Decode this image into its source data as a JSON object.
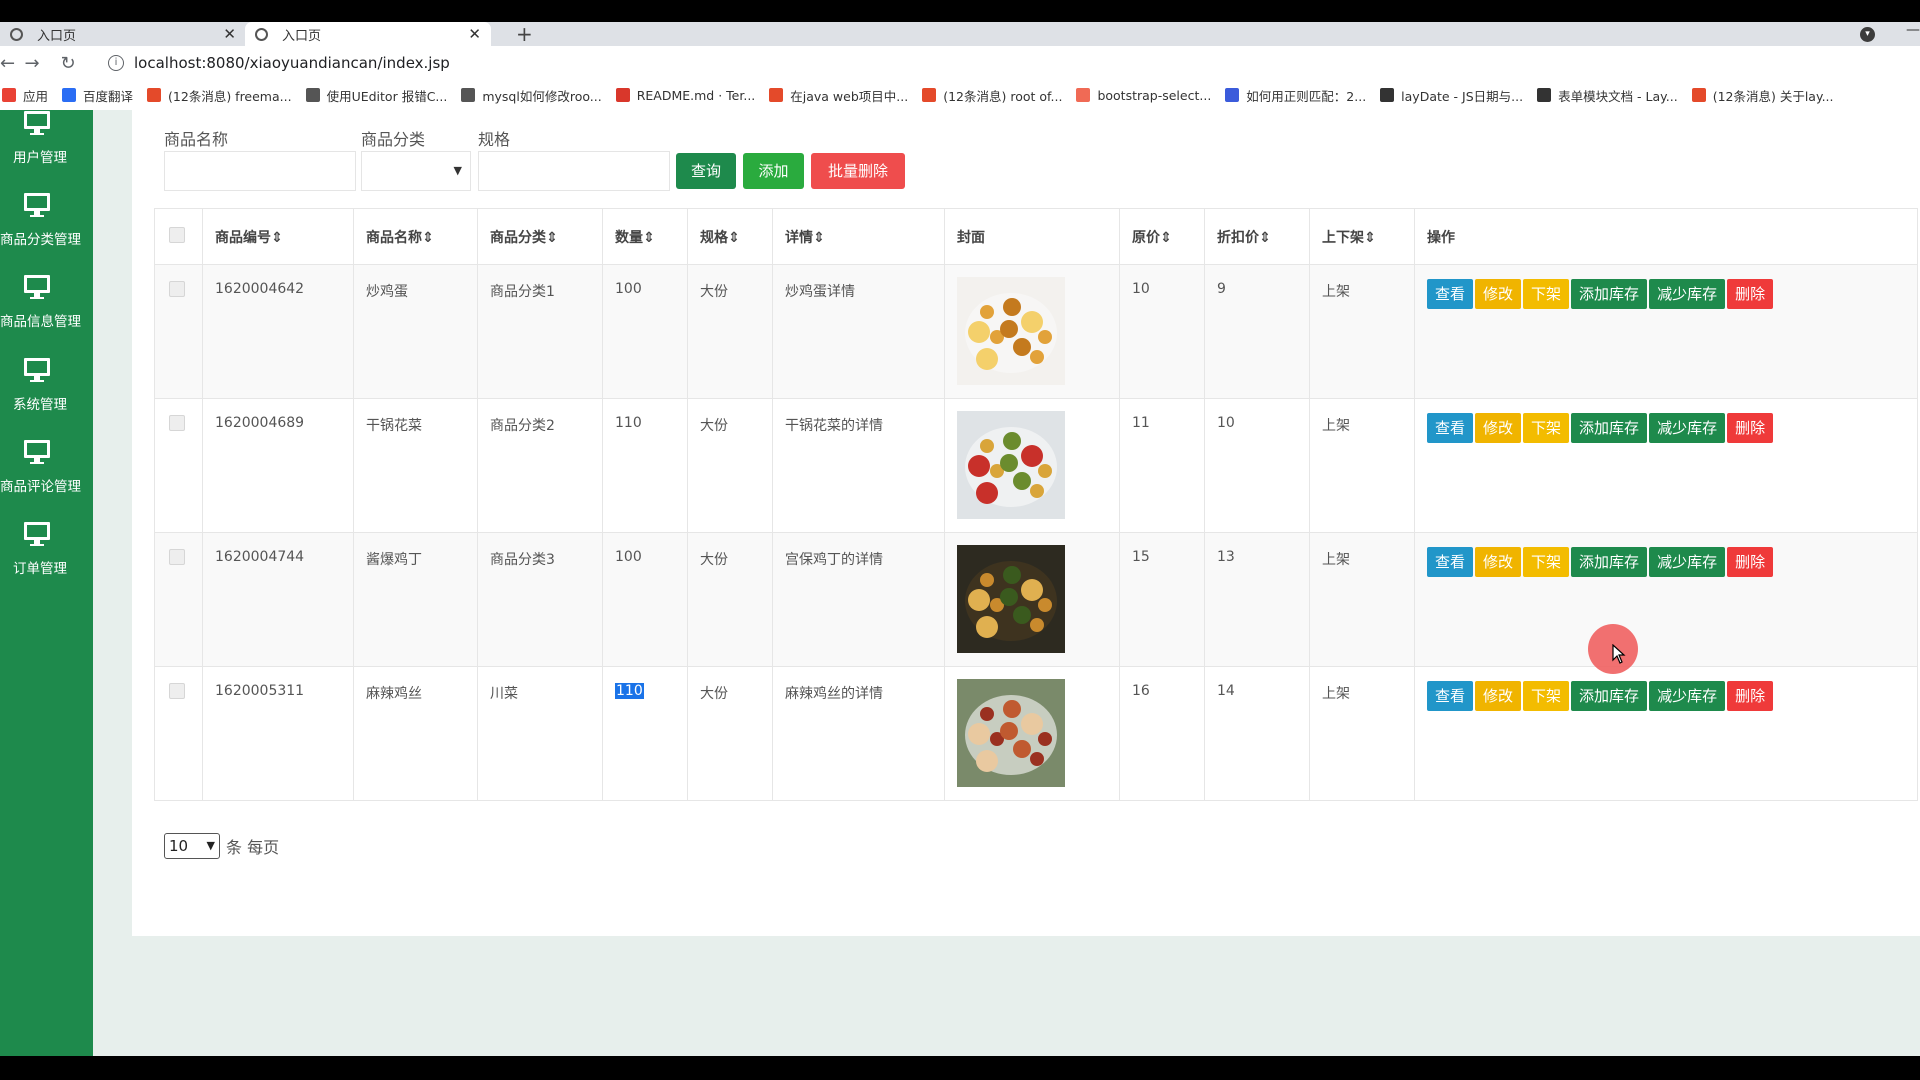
{
  "browser": {
    "tabs": [
      {
        "title": "入口页"
      },
      {
        "title": "入口页"
      }
    ],
    "url": "localhost:8080/xiaoyuandiancan/index.jsp",
    "bookmarks": [
      {
        "label": "应用",
        "color": "#e94235"
      },
      {
        "label": "百度翻译",
        "color": "#2a6df4"
      },
      {
        "label": "(12条消息) freema...",
        "color": "#e44a2a"
      },
      {
        "label": "使用UEditor 报错C...",
        "color": "#555555"
      },
      {
        "label": "mysql如何修改roo...",
        "color": "#555555"
      },
      {
        "label": "README.md · Ter...",
        "color": "#d9372b"
      },
      {
        "label": "在java web项目中...",
        "color": "#e44a2a"
      },
      {
        "label": "(12条消息) root of...",
        "color": "#e44a2a"
      },
      {
        "label": "bootstrap-select...",
        "color": "#f06a55"
      },
      {
        "label": "如何用正则匹配：2...",
        "color": "#3b5bdb"
      },
      {
        "label": "layDate - JS日期与...",
        "color": "#333333"
      },
      {
        "label": "表单模块文档 - Lay...",
        "color": "#333333"
      },
      {
        "label": "(12条消息) 关于lay...",
        "color": "#e44a2a"
      }
    ]
  },
  "sidebar": {
    "items": [
      {
        "label": "用户管理"
      },
      {
        "label": "商品分类管理"
      },
      {
        "label": "商品信息管理"
      },
      {
        "label": "系统管理"
      },
      {
        "label": "商品评论管理"
      },
      {
        "label": "订单管理"
      }
    ]
  },
  "search": {
    "name_label": "商品名称",
    "category_label": "商品分类",
    "spec_label": "规格",
    "query_button": "查询",
    "add_button": "添加",
    "batch_delete_button": "批量删除"
  },
  "table": {
    "headers": [
      "商品编号",
      "商品名称",
      "商品分类",
      "数量",
      "规格",
      "详情",
      "封面",
      "原价",
      "折扣价",
      "上下架",
      "操作"
    ],
    "sort_icon": "⇕",
    "rows": [
      {
        "id": "1620004642",
        "name": "炒鸡蛋",
        "category": "商品分类1",
        "quantity": "100",
        "spec": "大份",
        "detail": "炒鸡蛋详情",
        "price": "10",
        "discount": "9",
        "status": "上架"
      },
      {
        "id": "1620004689",
        "name": "干锅花菜",
        "category": "商品分类2",
        "quantity": "110",
        "spec": "大份",
        "detail": "干锅花菜的详情",
        "price": "11",
        "discount": "10",
        "status": "上架"
      },
      {
        "id": "1620004744",
        "name": "酱爆鸡丁",
        "category": "商品分类3",
        "quantity": "100",
        "spec": "大份",
        "detail": "宫保鸡丁的详情",
        "price": "15",
        "discount": "13",
        "status": "上架"
      },
      {
        "id": "1620005311",
        "name": "麻辣鸡丝",
        "category": "川菜",
        "quantity": "110",
        "spec": "大份",
        "detail": "麻辣鸡丝的详情",
        "price": "16",
        "discount": "14",
        "status": "上架"
      }
    ],
    "actions": {
      "view": "查看",
      "edit": "修改",
      "unlist": "下架",
      "add_stock": "添加库存",
      "reduce_stock": "减少库存",
      "delete": "删除"
    }
  },
  "pagination": {
    "page_size": "10",
    "suffix": "条 每页"
  },
  "colors": {
    "sidebar": "#1e8a4c",
    "primary": "#1e8a4c",
    "view": "#2196c9",
    "warning": "#f0b400",
    "danger": "#ef3a3a"
  }
}
